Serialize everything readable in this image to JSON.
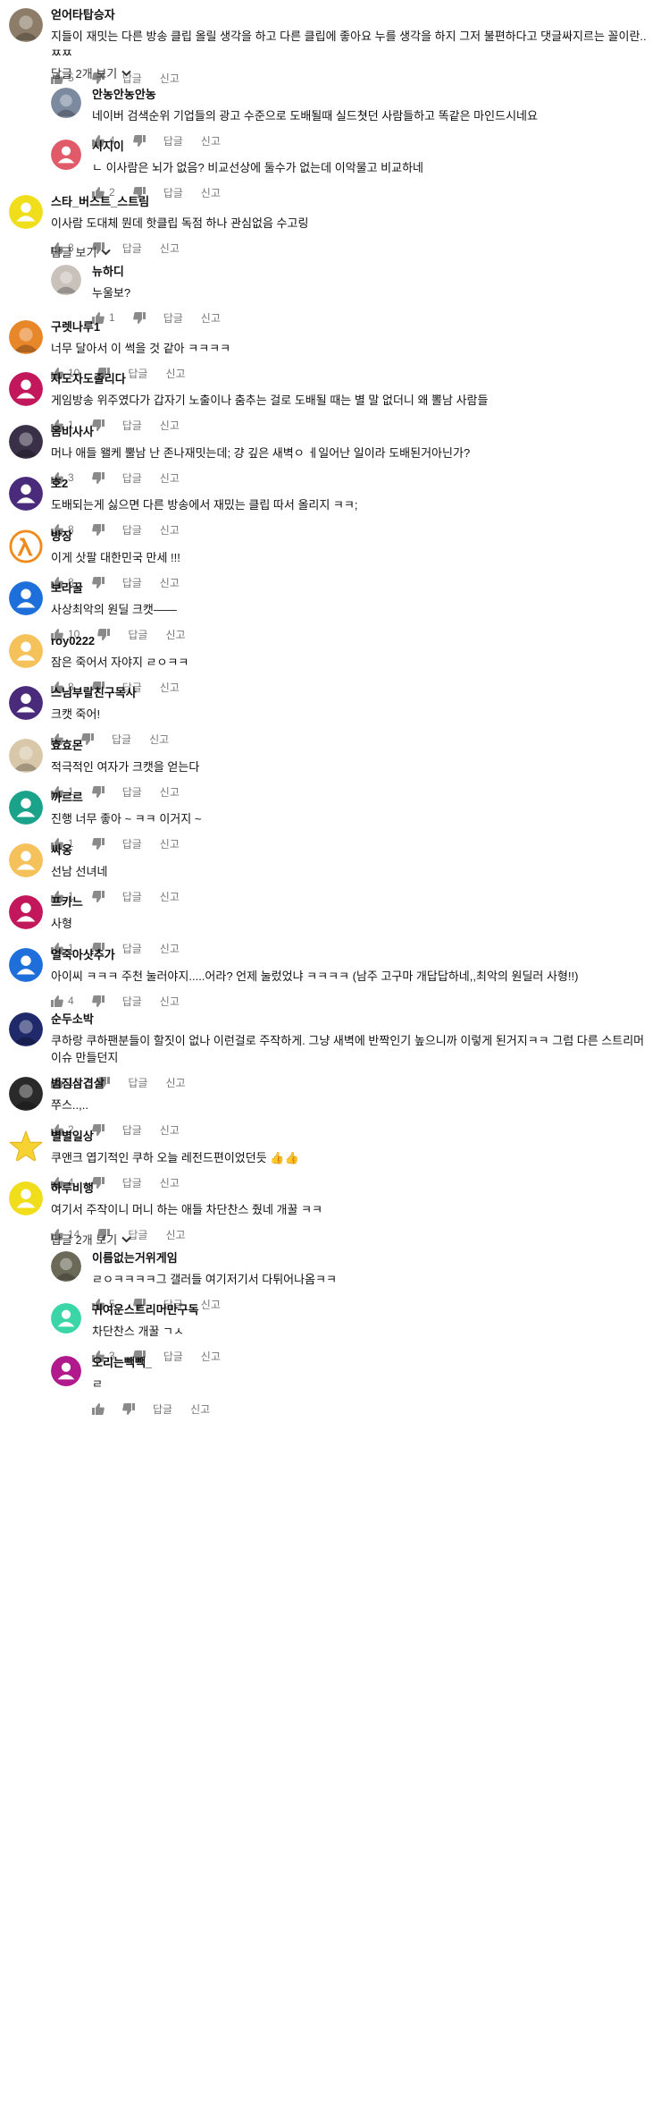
{
  "labels": {
    "reply": "답글",
    "report": "신고"
  },
  "colors": {
    "meta": "#777777",
    "name": "#111111",
    "text": "#111111"
  },
  "comments": [
    {
      "name": "얻어타탑승자",
      "text": "지들이 재밋는 다른 방송 클립 올릴 생각을 하고 다른 클립에 좋아요 누를 생각을 하지 그저 불편하다고 댓글싸지르는 꼴이란.. ㅉㅉ",
      "likes": "5",
      "avatar": {
        "kind": "photo",
        "bg": "#8d7d68"
      }
    },
    {
      "name": "안농안농안농",
      "text": "네이버 검색순위 기업들의 광고 수준으로 도배될때 실드쳣던 사람들하고 똑같은 마인드시네요",
      "likes": "4",
      "avatar": {
        "kind": "photo",
        "bg": "#7c8aa0"
      }
    },
    {
      "name": "시지이",
      "text": "ㄴ 이사람은 뇌가 없음? 비교선상에 둘수가 없는데 이악물고 비교하네",
      "likes": "2",
      "avatar": {
        "kind": "default",
        "bg": "#e05a6a"
      }
    },
    {
      "name": "스타_버스트_스트림",
      "text": "이사람 도대체 뭔데 핫클립 독점 하나 관심없음 수고링",
      "likes": "8",
      "avatar": {
        "kind": "default",
        "bg": "#f0dd1c"
      }
    },
    {
      "name": "뉴하디",
      "text": "누울보?",
      "likes": "1",
      "avatar": {
        "kind": "photo",
        "bg": "#c9c2bb"
      }
    },
    {
      "name": "구렛나루1",
      "text": "너무 달아서 이 썩을 것 같아 ㅋㅋㅋㅋ",
      "likes": "10",
      "avatar": {
        "kind": "photo",
        "bg": "#e8862a"
      }
    },
    {
      "name": "자도자도졸리다",
      "text": "게임방송 위주였다가 갑자기 노출이나 춤추는 걸로 도배될 때는 별 말 없더니 왜 뽈남 사람들",
      "likes": "1",
      "avatar": {
        "kind": "default",
        "bg": "#c2185b"
      }
    },
    {
      "name": "옴비사사",
      "text": "머나 애들 왤케 뿔남 난 존나재밋는데; 걍 깊은 새벽ㅇ ㅔ일어난 일이라 도배된거아닌가?",
      "likes": "3",
      "avatar": {
        "kind": "photo",
        "bg": "#3a3048"
      }
    },
    {
      "name": "호2",
      "text": "도배되는게 싫으면 다른 방송에서 재밌는 클립 따서 올리지 ㅋㅋ;",
      "likes": "8",
      "avatar": {
        "kind": "default",
        "bg": "#4a2a7a"
      }
    },
    {
      "name": "방장",
      "text": "이게 삿팔 대한민국 만세 !!!",
      "likes": "8",
      "avatar": {
        "kind": "lambda",
        "bg": "#ffffff"
      }
    },
    {
      "name": "보라꿀",
      "text": "사상최악의 원딜 크캣——",
      "likes": "10",
      "avatar": {
        "kind": "default",
        "bg": "#1e6fd9"
      }
    },
    {
      "name": "roy0222",
      "text": "잠은 죽어서 자야지 ㄹㅇㅋㅋ",
      "likes": "8",
      "avatar": {
        "kind": "default",
        "bg": "#f5c15a"
      }
    },
    {
      "name": "스님부랄친구목사",
      "text": "크캣 죽어!",
      "likes": "",
      "avatar": {
        "kind": "default",
        "bg": "#4a2a7a"
      }
    },
    {
      "name": "효효몬",
      "text": "적극적인 여자가 크캣을 얻는다",
      "likes": "1",
      "avatar": {
        "kind": "photo",
        "bg": "#d8c7a8"
      }
    },
    {
      "name": "까르르",
      "text": "진행 너무 좋아 ~ ㅋㅋ 이거지 ~",
      "likes": "1",
      "avatar": {
        "kind": "default",
        "bg": "#1aa38a"
      }
    },
    {
      "name": "싸옹",
      "text": "선남 선녀네",
      "likes": "1",
      "avatar": {
        "kind": "default",
        "bg": "#f5c15a"
      }
    },
    {
      "name": "프카느",
      "text": "사형",
      "likes": "1",
      "avatar": {
        "kind": "default",
        "bg": "#c2185b"
      }
    },
    {
      "name": "얼죽아샷추가",
      "text": "아이씨 ㅋㅋㅋ 주천 눌러야지.....어라? 언제 눌렀었냐 ㅋㅋㅋㅋ (남주 고구마 개답답하네,,최악의 원딜러 사형!!)",
      "likes": "4",
      "avatar": {
        "kind": "default",
        "bg": "#1e6fd9"
      }
    },
    {
      "name": "순두소박",
      "text": "쿠하랑 쿠하팬분들이 할짓이 없나 이런걸로 주작하게. 그냥 새벽에 반짝인기 높으니까 이렇게 된거지ㅋㅋ 그럼 다른 스트리머 이슈 만들던지",
      "likes": "13",
      "avatar": {
        "kind": "photo",
        "bg": "#202a6a"
      }
    },
    {
      "name": "범짐삼겹살",
      "text": "쭈스..,..",
      "likes": "2",
      "avatar": {
        "kind": "photo",
        "bg": "#2a2a2a"
      }
    },
    {
      "name": "별별일상",
      "text": "쿠앤크 엽기적인 쿠하 오늘 레전드편이었던듯 👍👍",
      "likes": "4",
      "avatar": {
        "kind": "star",
        "bg": "#ffffff"
      }
    },
    {
      "name": "하루비행",
      "text": "여기서 주작이니 머니 하는 애들 차단찬스 줬네 개꿀 ㅋㅋ",
      "likes": "14",
      "avatar": {
        "kind": "default",
        "bg": "#f0dd1c"
      }
    },
    {
      "name": "이름없는거위게임",
      "text": "ㄹㅇㅋㅋㅋㅋ그 갤러들 여기저기서 다튀어나옴ㅋㅋ",
      "likes": "5",
      "avatar": {
        "kind": "photo",
        "bg": "#6b6a58"
      }
    },
    {
      "name": "귀여운스트리머만구독",
      "text": "차단찬스 개꿀 ㄱㅅ",
      "likes": "3",
      "avatar": {
        "kind": "default",
        "bg": "#3ad6a8"
      }
    },
    {
      "name": "오리는빽빽_",
      "text": "ㄹ",
      "likes": "",
      "avatar": {
        "kind": "default",
        "bg": "#b01a8c"
      }
    }
  ],
  "view_replies": [
    {
      "label": "답글 2개 보기"
    },
    {
      "label": "답글 보기"
    },
    {
      "label": "답글 2개 보기"
    }
  ]
}
